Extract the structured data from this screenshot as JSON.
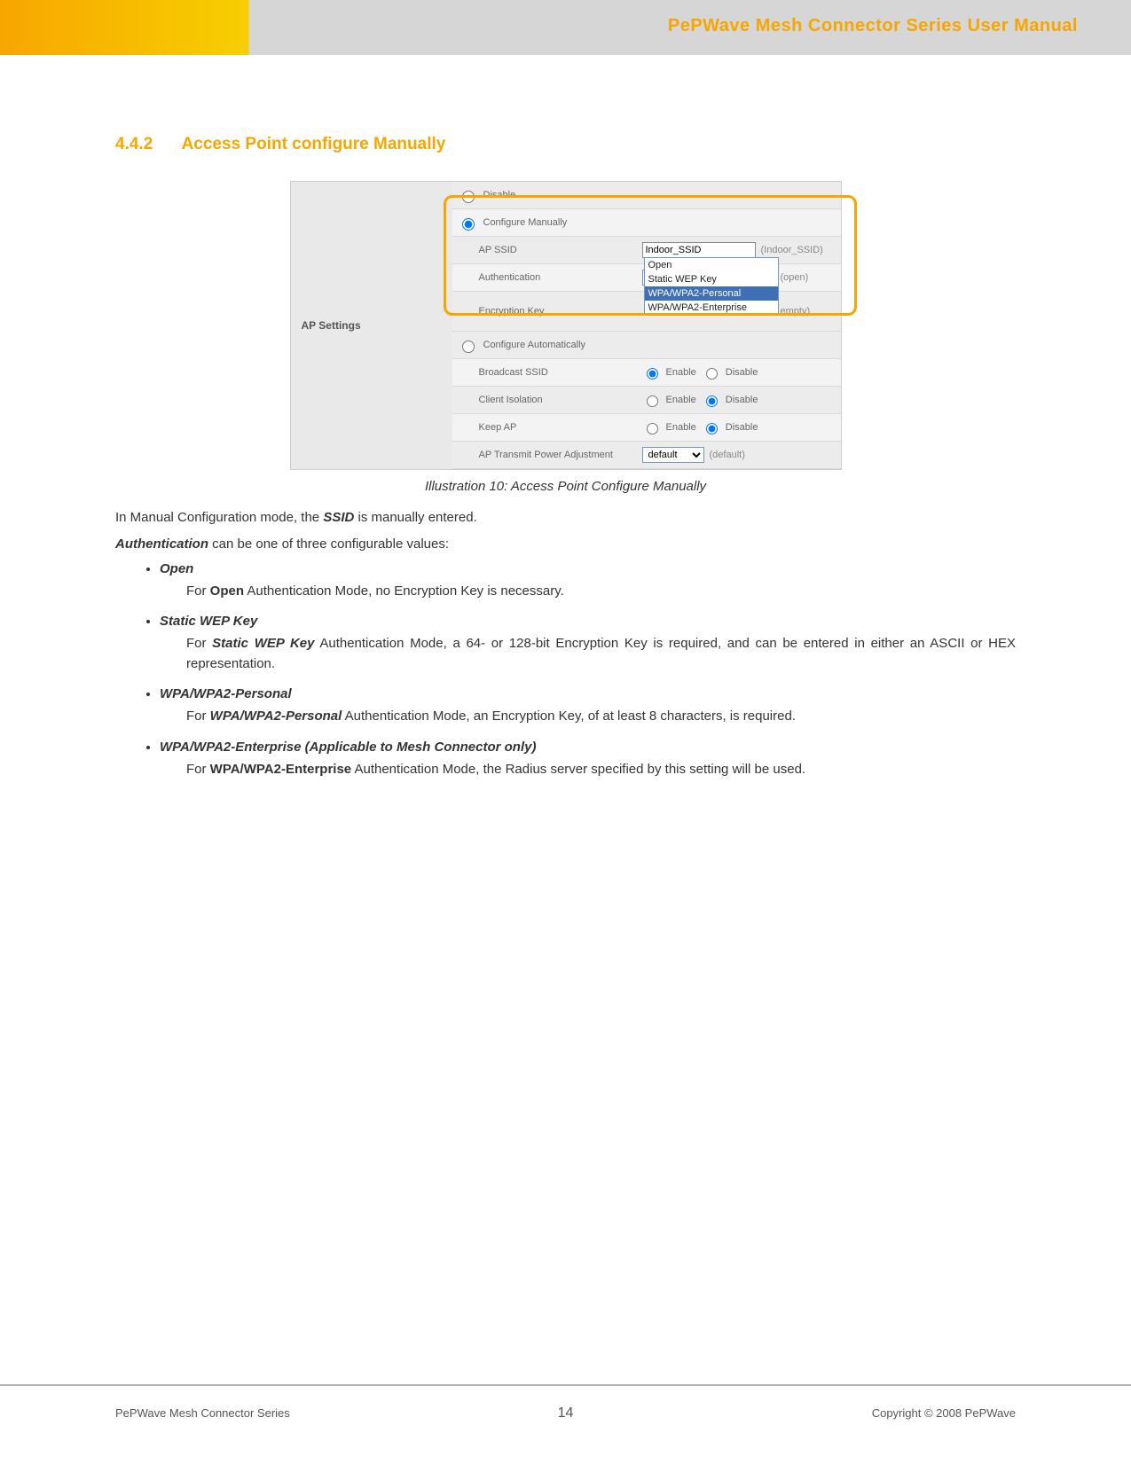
{
  "header": {
    "manual_title": "PePWave Mesh Connector Series User Manual"
  },
  "section": {
    "number": "4.4.2",
    "title": "Access Point configure Manually"
  },
  "screenshot": {
    "panel_label": "AP Settings",
    "rows": {
      "disable": "Disable",
      "configure_manually": "Configure Manually",
      "ap_ssid_label": "AP SSID",
      "ap_ssid_value": "Indoor_SSID",
      "ap_ssid_hint": "(Indoor_SSID)",
      "authentication_label": "Authentication",
      "authentication_value": "WPA/WPA2-Personal",
      "authentication_hint": "(open)",
      "encryption_key_label": "Encryption Key",
      "encryption_key_hint": "empty)",
      "configure_auto": "Configure Automatically",
      "broadcast_ssid_label": "Broadcast SSID",
      "client_isolation_label": "Client Isolation",
      "keep_ap_label": "Keep AP",
      "power_adj_label": "AP Transmit Power Adjustment",
      "power_adj_value": "default",
      "power_adj_hint": "(default)",
      "enable": "Enable",
      "disable_opt": "Disable"
    },
    "dropdown": {
      "open": "Open",
      "static_wep": "Static WEP Key",
      "wpa_personal": "WPA/WPA2-Personal",
      "wpa_enterprise": "WPA/WPA2-Enterprise"
    }
  },
  "caption": "Illustration 10: Access Point Configure Manually",
  "body": {
    "line1_pre": "In Manual Configuration mode, the ",
    "line1_bold": "SSID",
    "line1_post": " is manually entered.",
    "line2_bold": "Authentication",
    "line2_post": " can be one of three configurable values:"
  },
  "list": {
    "open": {
      "label": "Open",
      "desc_pre": "For ",
      "desc_bold": "Open",
      "desc_post": " Authentication Mode, no Encryption Key is necessary."
    },
    "wep": {
      "label": "Static WEP Key",
      "desc_pre": "For ",
      "desc_bold": "Static WEP Key",
      "desc_post": " Authentication Mode, a 64- or 128-bit Encryption Key is required, and can be entered in either an ASCII or HEX representation."
    },
    "wpa_p": {
      "label": "WPA/WPA2-Personal",
      "desc_pre": "For ",
      "desc_bold": "WPA/WPA2-Personal",
      "desc_post": " Authentication Mode, an Encryption Key, of at least 8 characters, is required."
    },
    "wpa_e": {
      "label": "WPA/WPA2-Enterprise (Applicable to Mesh Connector only)",
      "desc_pre": "For ",
      "desc_bold": "WPA/WPA2-Enterprise",
      "desc_post": " Authentication Mode, the Radius server specified by this setting will be used."
    }
  },
  "footer": {
    "left": "PePWave  Mesh Connector Series",
    "center": "14",
    "right": "Copyright © 2008 PePWave"
  }
}
